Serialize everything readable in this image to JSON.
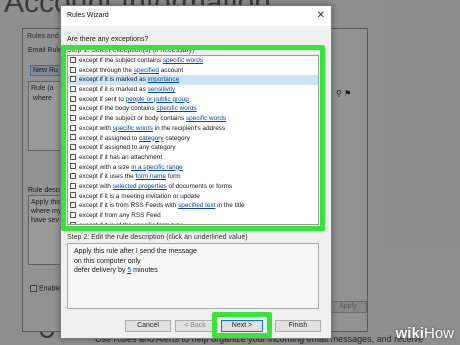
{
  "background": {
    "title": "Account Information",
    "footer_text": "Use Rules and Alerts to help organize your incoming email messages, and receive"
  },
  "rules_alerts": {
    "title": "Rules and A",
    "tab": "Email Rules",
    "new_rule": "New Ru",
    "column": "Rule (a",
    "where": "where",
    "description_label": "Rule description",
    "description_lines": [
      "Apply this",
      "where my",
      "have sev"
    ],
    "enable_label": "Enable r",
    "apply": "Apply"
  },
  "wizard": {
    "title": "Rules Wizard",
    "close": "✕",
    "question": "Are there any exceptions?",
    "step1": "Step 1: Select exception(s) (if necessary)",
    "step2": "Step 2: Edit the rule description (click an underlined value)",
    "conditions": [
      {
        "pre": "except if the subject contains ",
        "link": "specific words",
        "post": ""
      },
      {
        "pre": "except through the ",
        "link": "specified",
        "post": " account"
      },
      {
        "pre": "except if it is marked as ",
        "link": "importance",
        "post": ""
      },
      {
        "pre": "except if it is marked as ",
        "link": "sensitivity",
        "post": ""
      },
      {
        "pre": "except if sent to ",
        "link": "people or public group",
        "post": ""
      },
      {
        "pre": "except if the body contains ",
        "link": "specific words",
        "post": ""
      },
      {
        "pre": "except if the subject or body contains ",
        "link": "specific words",
        "post": ""
      },
      {
        "pre": "except with ",
        "link": "specific words",
        "post": " in the recipient's address"
      },
      {
        "pre": "except if assigned to ",
        "link": "category",
        "post": " category"
      },
      {
        "pre": "except if assigned to any category",
        "link": "",
        "post": ""
      },
      {
        "pre": "except if it has an attachment",
        "link": "",
        "post": ""
      },
      {
        "pre": "except with a size ",
        "link": "in a specific range",
        "post": ""
      },
      {
        "pre": "except if it uses the ",
        "link": "form name",
        "post": " form"
      },
      {
        "pre": "except with ",
        "link": "selected properties",
        "post": " of documents or forms"
      },
      {
        "pre": "except if it is a meeting invitation or update",
        "link": "",
        "post": ""
      },
      {
        "pre": "except if it is from RSS Feeds with ",
        "link": "specified text",
        "post": " in the title"
      },
      {
        "pre": "except if from any RSS Feed",
        "link": "",
        "post": ""
      },
      {
        "pre": "except if it is of the ",
        "link": "specific",
        "post": " form type"
      }
    ],
    "description": {
      "line1": "Apply this rule after I send the message",
      "line2": "on this computer only",
      "line3_pre": "defer delivery by ",
      "line3_link": "5",
      "line3_post": " minutes"
    },
    "buttons": {
      "cancel": "Cancel",
      "back": "< Back",
      "next": "Next >",
      "finish": "Finish"
    }
  },
  "watermark": {
    "wiki": "wiki",
    "how": "How"
  },
  "colors": {
    "highlight": "#37e53a",
    "link": "#0645ad",
    "selection": "#cce4f7"
  }
}
